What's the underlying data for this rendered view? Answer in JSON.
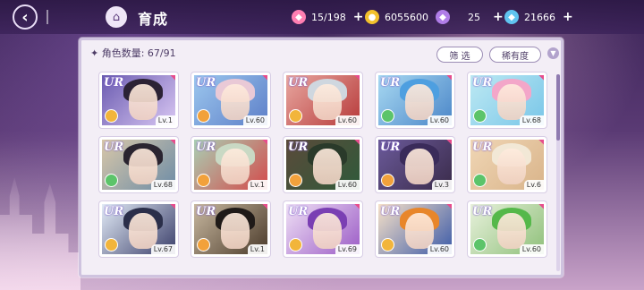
{
  "header": {
    "title": "育成"
  },
  "resources": [
    {
      "icon": "candy-icon",
      "value": "15/198",
      "color": "#ff7fb2"
    },
    {
      "icon": "coin-icon",
      "value": "6055600",
      "color": "#f3c12c"
    },
    {
      "icon": "gem-icon",
      "value": "25",
      "color": "#b07de8"
    },
    {
      "icon": "diamond-icon",
      "value": "21666",
      "color": "#60c4f0"
    }
  ],
  "panel": {
    "count_label": "✦ 角色数量: 67/91",
    "filter_label": "筛 选",
    "sort_label": "稀有度"
  },
  "cards": [
    {
      "rarity": "UR",
      "level": "Lv.1",
      "element_color": "#f2b53b",
      "art": [
        "#6a5bb0",
        "#d9c7f3"
      ],
      "hair": "#2b2234"
    },
    {
      "rarity": "UR",
      "level": "Lv.60",
      "element_color": "#f2a13b",
      "art": [
        "#9cc7ee",
        "#5d7fc8"
      ],
      "hair": "#e9c9d6"
    },
    {
      "rarity": "UR",
      "level": "Lv.60",
      "element_color": "#f2b53b",
      "art": [
        "#e8a7a0",
        "#b73a3a"
      ],
      "hair": "#cfd7df"
    },
    {
      "rarity": "UR",
      "level": "Lv.60",
      "element_color": "#5cc46a",
      "art": [
        "#a8d9f2",
        "#4b86c8"
      ],
      "hair": "#4e9fe0"
    },
    {
      "rarity": "UR",
      "level": "Lv.68",
      "element_color": "#5cc46a",
      "art": [
        "#bde9f3",
        "#79c6e8"
      ],
      "hair": "#f3a6c9"
    },
    {
      "rarity": "UR",
      "level": "Lv.68",
      "element_color": "#5cc46a",
      "art": [
        "#d8c7a8",
        "#6d8ca7"
      ],
      "hair": "#2a2430"
    },
    {
      "rarity": "UR",
      "level": "Lv.1",
      "element_color": "#f2a13b",
      "art": [
        "#a9cfb4",
        "#d44a4a"
      ],
      "hair": "#c9d9c4"
    },
    {
      "rarity": "UR",
      "level": "Lv.60",
      "element_color": "#f2a13b",
      "art": [
        "#5b4a3a",
        "#2f5a3a"
      ],
      "hair": "#2a3a2a"
    },
    {
      "rarity": "UR",
      "level": "Lv.3",
      "element_color": "#f2a13b",
      "art": [
        "#6b5a9a",
        "#3a2b4a"
      ],
      "hair": "#3a2b5a"
    },
    {
      "rarity": "UR",
      "level": "Lv.6",
      "element_color": "#5cc46a",
      "art": [
        "#f0d6b5",
        "#d9b48a"
      ],
      "hair": "#f2e8d6"
    },
    {
      "rarity": "UR",
      "level": "Lv.67",
      "element_color": "#f2b53b",
      "art": [
        "#e2ebf6",
        "#3b3f6a"
      ],
      "hair": "#2b2f4a"
    },
    {
      "rarity": "UR",
      "level": "Lv.1",
      "element_color": "#f2a13b",
      "art": [
        "#c8b8a0",
        "#4a3a2a"
      ],
      "hair": "#1f1a18"
    },
    {
      "rarity": "UR",
      "level": "Lv.69",
      "element_color": "#f2b53b",
      "art": [
        "#efe0f5",
        "#9b5bc6"
      ],
      "hair": "#7a3fb3"
    },
    {
      "rarity": "UR",
      "level": "Lv.60",
      "element_color": "#f2b53b",
      "art": [
        "#f7e1c8",
        "#3b5aa8"
      ],
      "hair": "#e8862a"
    },
    {
      "rarity": "UR",
      "level": "Lv.60",
      "element_color": "#5cc46a",
      "art": [
        "#e8f1dc",
        "#8fc07a"
      ],
      "hair": "#55b84a"
    }
  ]
}
